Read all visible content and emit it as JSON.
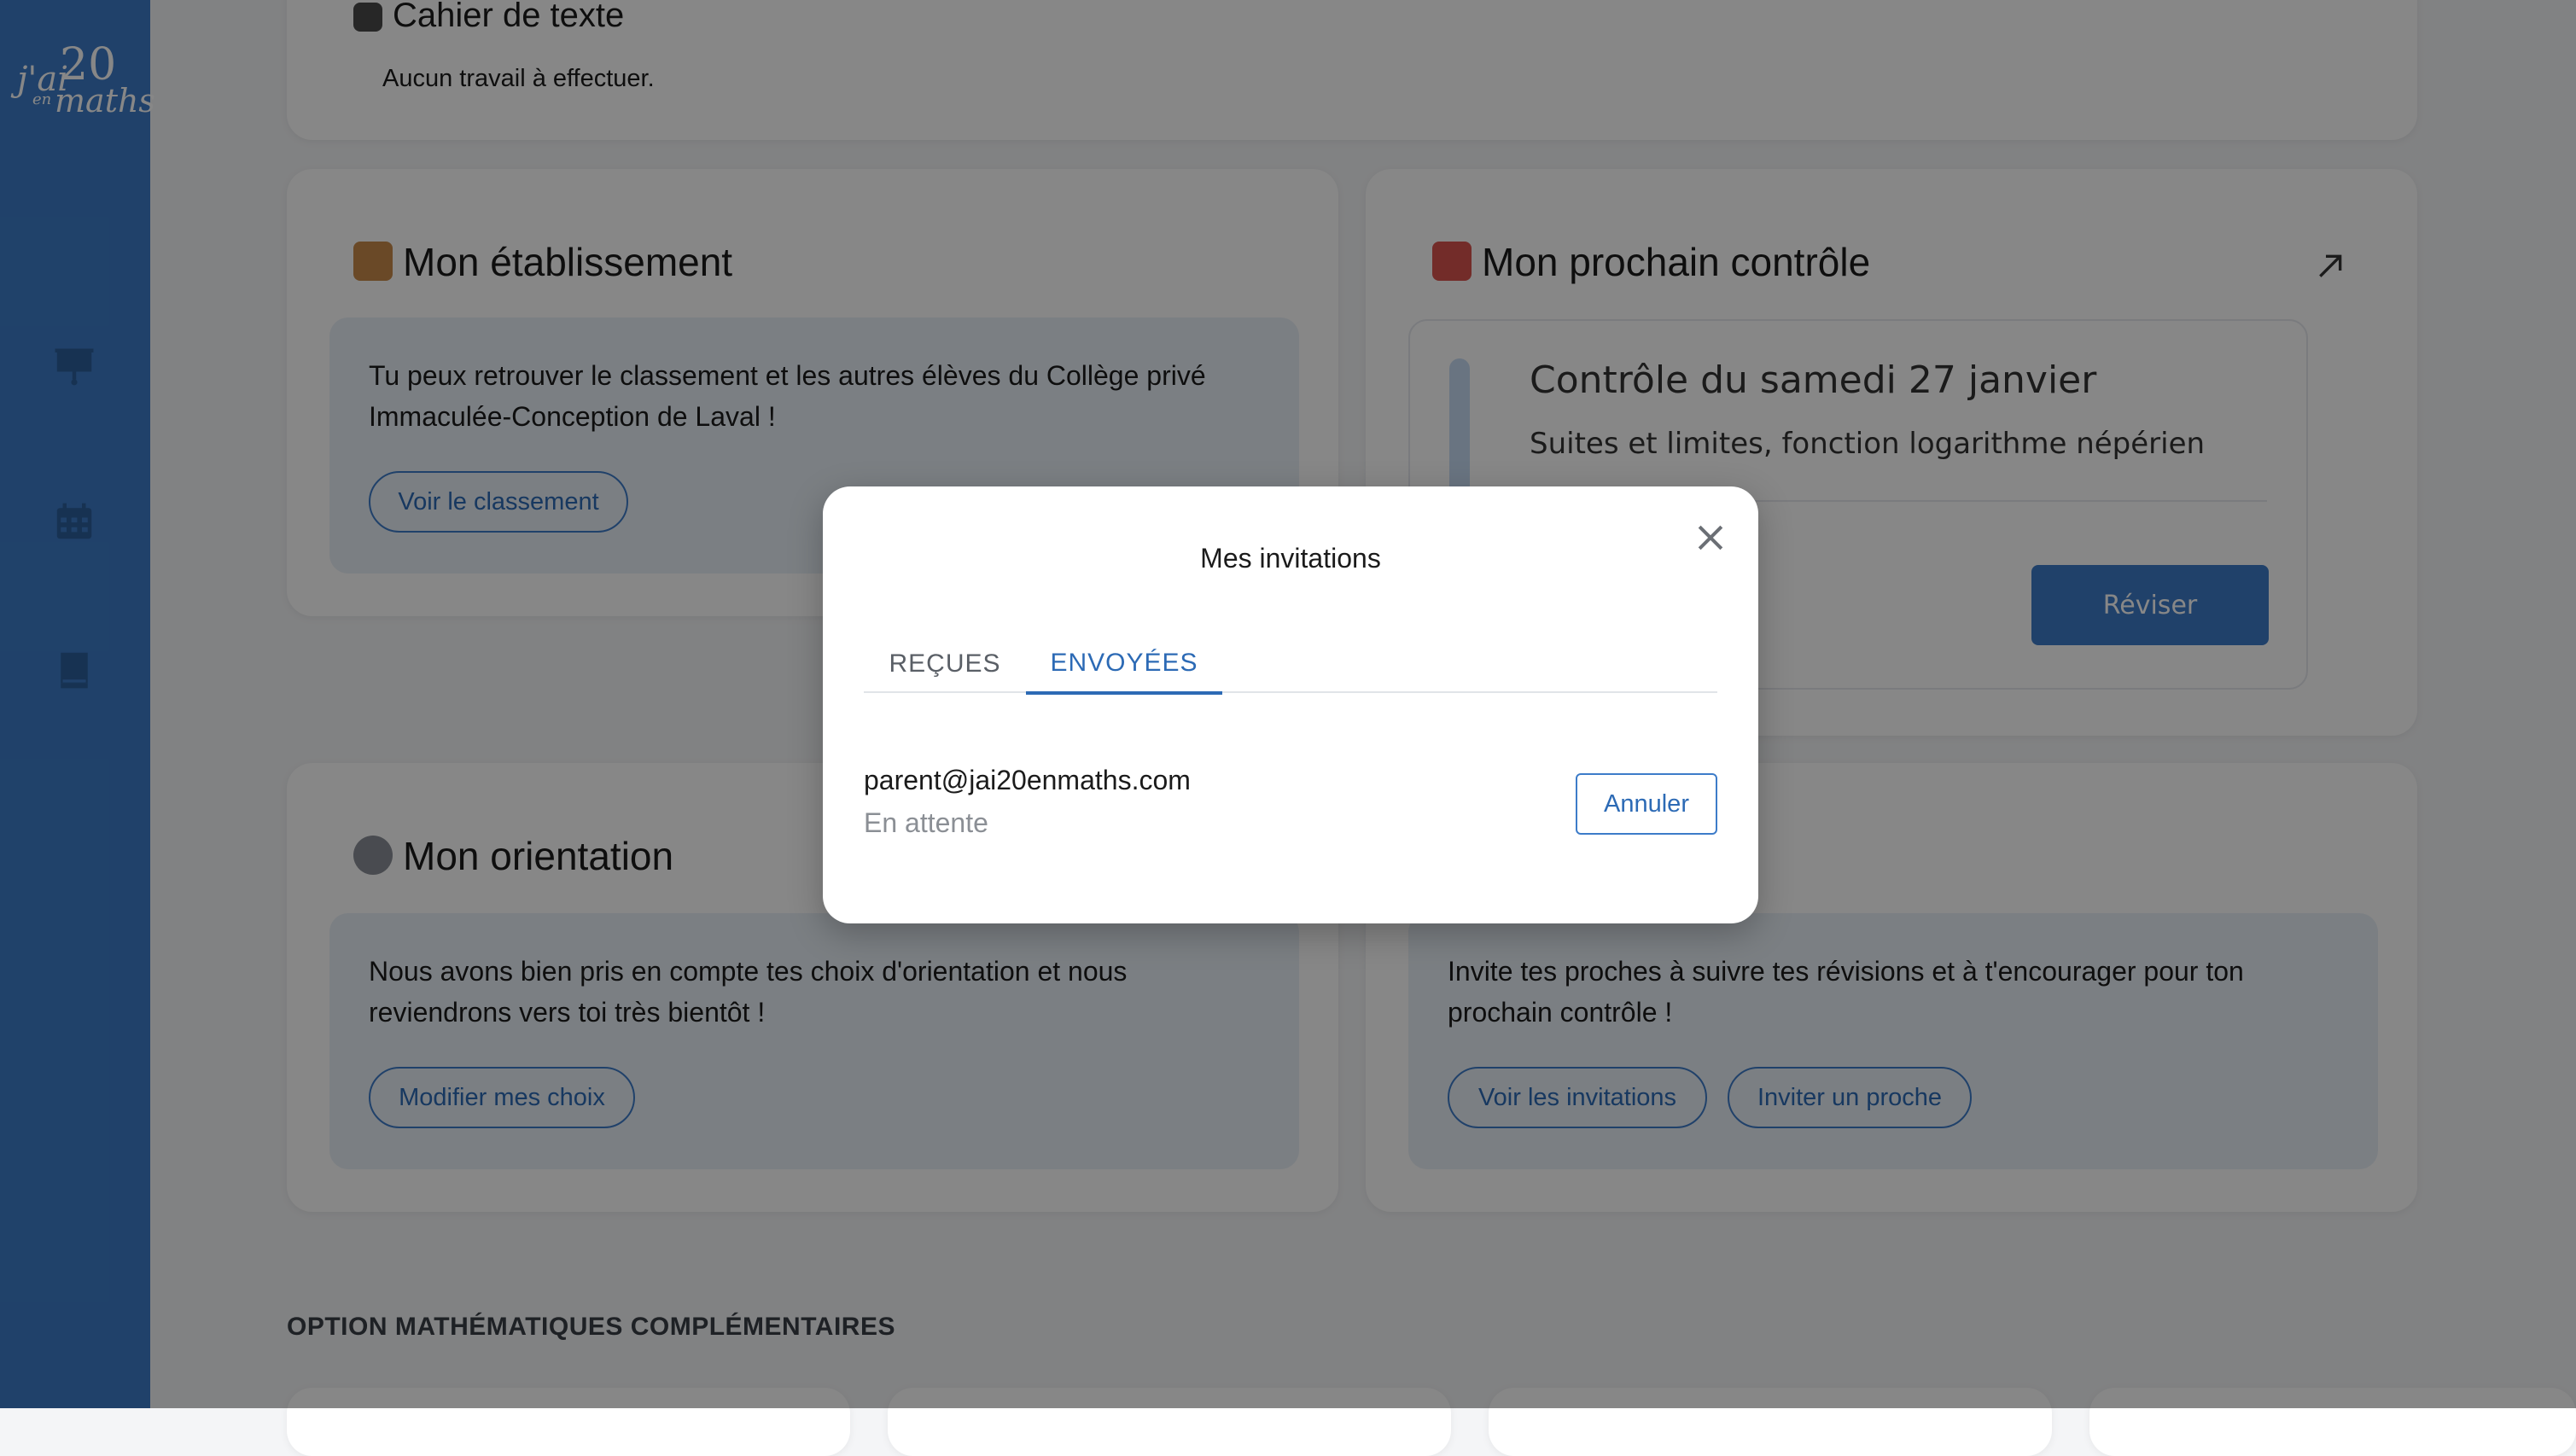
{
  "logo": {
    "line1": "j'ai",
    "line2": "20",
    "line3": "en",
    "line4": "maths"
  },
  "sidebar": {
    "items": [
      {
        "icon": "presentation-icon"
      },
      {
        "icon": "calendar-icon"
      },
      {
        "icon": "book-icon"
      }
    ]
  },
  "cahier": {
    "title": "Cahier de texte",
    "text": "Aucun travail à effectuer."
  },
  "etablissement": {
    "title": "Mon établissement",
    "text_line1": "Tu peux retrouver le classement et les autres élèves du Collège privé",
    "text_line2": "Immaculée-Conception de Laval !",
    "button": "Voir le classement"
  },
  "controle": {
    "title": "Mon prochain contrôle",
    "subtitle": "Contrôle du samedi 27 janvier",
    "topics": "Suites et limites, fonction logarithme népérien",
    "button": "Réviser"
  },
  "orientation": {
    "title": "Mon orientation",
    "text_line1": "Nous avons bien pris en compte tes choix d'orientation et nous",
    "text_line2": "reviendrons vers toi très bientôt !",
    "button": "Modifier mes choix"
  },
  "proches": {
    "text_line1": "Invite tes proches à suivre tes révisions et à t'encourager pour ton",
    "text_line2": "prochain contrôle !",
    "button_view": "Voir les invitations",
    "button_invite": "Inviter un proche"
  },
  "section_option": {
    "title": "OPTION MATHÉMATIQUES COMPLÉMENTAIRES"
  },
  "modal": {
    "title": "Mes invitations",
    "tabs": [
      {
        "label": "REÇUES",
        "active": false
      },
      {
        "label": "ENVOYÉES",
        "active": true
      }
    ],
    "invitation": {
      "email": "parent@jai20enmaths.com",
      "status": "En attente",
      "action": "Annuler"
    }
  },
  "colors": {
    "accent": "#3d7cc9",
    "link": "#2c6ab5",
    "panel": "#e9f0f8"
  }
}
